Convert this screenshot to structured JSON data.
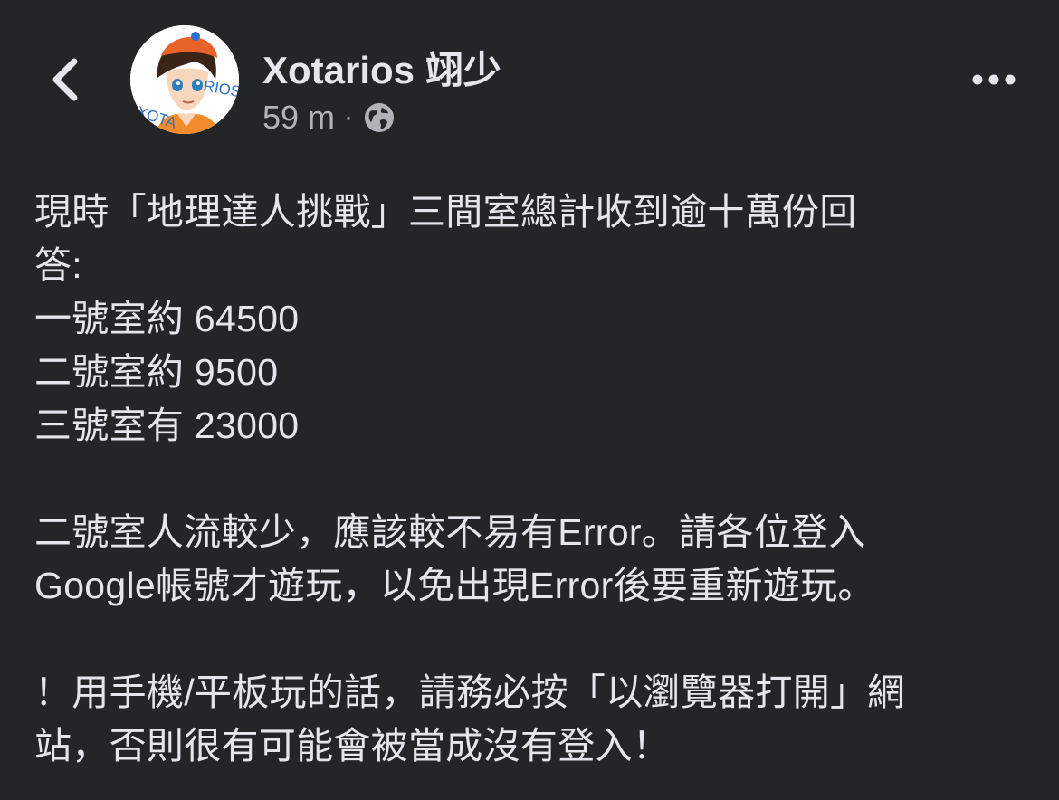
{
  "header": {
    "author_name": "Xotarios 翊少",
    "timestamp": "59 m",
    "separator": "·",
    "privacy_icon": "globe-icon",
    "back_icon": "chevron-left-icon",
    "more_icon": "more-horizontal-icon",
    "avatar_text": "XOTARIOS"
  },
  "post": {
    "lines": [
      "現時「地理達人挑戰」三間室總計收到逾十萬份回",
      "答:",
      "一號室約 64500",
      "二號室約 9500",
      "三號室有 23000",
      "",
      "二號室人流較少，應該較不易有Error。請各位登入",
      "Google帳號才遊玩，以免出現Error後要重新遊玩。",
      "",
      "！用手機/平板玩的話，請務必按「以瀏覽器打開」網",
      "站，否則很有可能會被當成沒有登入！"
    ]
  },
  "colors": {
    "background": "#242526",
    "primary_text": "#e4e6eb",
    "secondary_text": "#b0b3b8"
  }
}
